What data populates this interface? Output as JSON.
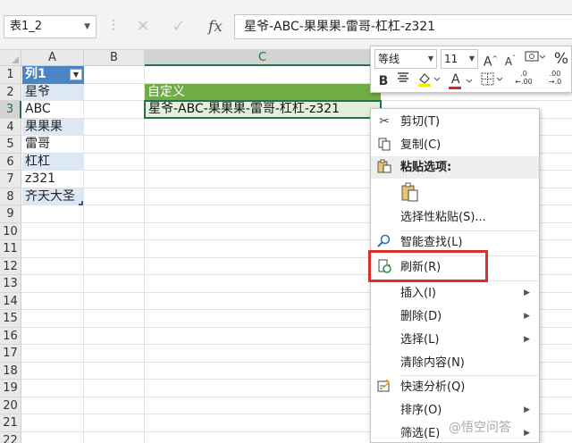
{
  "formula_bar": {
    "name_box": "表1_2",
    "cancel_symbol": "✕",
    "enter_symbol": "✓",
    "fx_symbol": "fx",
    "value": "星爷-ABC-果果果-雷哥-杠杠-z321"
  },
  "columns": [
    "A",
    "B",
    "C"
  ],
  "rows": [
    "1",
    "2",
    "3",
    "4",
    "5",
    "6",
    "7",
    "8",
    "9",
    "10",
    "11",
    "12",
    "13",
    "14",
    "15",
    "16",
    "17",
    "18",
    "19",
    "20",
    "21",
    "22"
  ],
  "table": {
    "header": "列1",
    "values": [
      "星爷",
      "ABC",
      "果果果",
      "雷哥",
      "杠杠",
      "z321",
      "齐天大圣"
    ]
  },
  "result": {
    "header": "自定义",
    "value": "星爷-ABC-果果果-雷哥-杠杠-z321"
  },
  "mini_toolbar": {
    "font_name": "等线",
    "font_size": "11",
    "grow_font": "A",
    "shrink_font": "A",
    "percent": "%",
    "bold": "B",
    "font_color": "A",
    "decrease_decimal": ".00\n→.0",
    "increase_decimal": ".0\n←.00"
  },
  "context_menu": {
    "items": [
      {
        "label": "剪切(T)",
        "icon": "scissors-icon"
      },
      {
        "label": "复制(C)",
        "icon": "copy-icon"
      },
      {
        "label": "粘贴选项:",
        "icon": "paste-icon"
      },
      {
        "label": "选择性粘贴(S)...",
        "icon": ""
      },
      {
        "label": "智能查找(L)",
        "icon": "smart-lookup-icon"
      },
      {
        "label": "刷新(R)",
        "icon": "refresh-icon"
      },
      {
        "label": "插入(I)",
        "icon": "",
        "submenu": true
      },
      {
        "label": "删除(D)",
        "icon": "",
        "submenu": true
      },
      {
        "label": "选择(L)",
        "icon": "",
        "submenu": true
      },
      {
        "label": "清除内容(N)",
        "icon": ""
      },
      {
        "label": "快速分析(Q)",
        "icon": "quick-analysis-icon"
      },
      {
        "label": "排序(O)",
        "icon": "",
        "submenu": true
      },
      {
        "label": "筛选(E)",
        "icon": "",
        "submenu": true
      }
    ]
  },
  "watermark": "@悟空问答",
  "colors": {
    "table_header": "#4a86c5",
    "table_band": "#dde8f5",
    "result_header": "#70ad47",
    "result_cell": "#e2efda",
    "selection": "#217346",
    "highlight_box": "#d9302b"
  }
}
